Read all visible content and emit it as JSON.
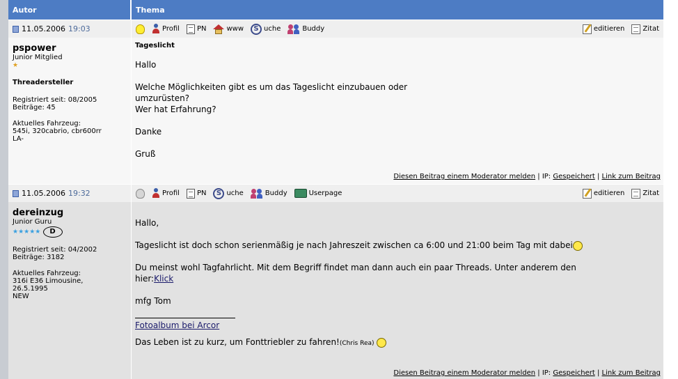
{
  "header": {
    "autor": "Autor",
    "thema": "Thema"
  },
  "tools_labels": {
    "profil": "Profil",
    "pn": "PN",
    "www": "www",
    "suche": "uche",
    "buddy": "Buddy",
    "userpage": "Userpage",
    "editieren": "editieren",
    "zitat": "Zitat"
  },
  "footer": {
    "report": "Diesen Beitrag einem Moderator melden",
    "sep1": "|",
    "ip_label": "IP:",
    "ip_value": "Gespeichert",
    "sep2": "|",
    "link": "Link zum Beitrag"
  },
  "posts": [
    {
      "date": "11.05.2006",
      "time": "19:03",
      "username": "pspower",
      "rank": "Junior Mitglied",
      "stars": "★",
      "role": "Threadersteller",
      "registered": "Registriert seit: 08/2005",
      "posts": "Beiträge: 45",
      "vehicle_label": "Aktuelles Fahrzeug:",
      "vehicle_1": "545i, 320cabrio, cbr600rr",
      "vehicle_2": "LA-",
      "title": "Tageslicht",
      "lines": [
        "Hallo",
        "Welche Möglichkeiten gibt es um das Tageslicht einzubauen oder",
        "umzurüsten?",
        "Wer hat Erfahrung?",
        "Danke",
        "Gruß"
      ]
    },
    {
      "date": "11.05.2006",
      "time": "19:32",
      "username": "dereinzug",
      "rank": "Junior Guru",
      "stars": "★★★★★",
      "badge": "D",
      "registered": "Registriert seit: 04/2002",
      "posts": "Beiträge: 3182",
      "vehicle_label": "Aktuelles Fahrzeug:",
      "vehicle_1": "316i E36 Limousine,",
      "vehicle_2": "26.5.1995",
      "vehicle_3": "NEW",
      "lines": [
        "Hallo,",
        "Tageslicht ist doch schon serienmäßig je nach Jahreszeit zwischen ca 6:00 und 21:00 beim Tag mit dabei",
        "Du meinst wohl Tagfahrlicht. Mit dem Begriff findet man dann auch ein paar Threads. Unter anderem den",
        "hier:",
        "Klick",
        "mfg Tom"
      ],
      "sig_link": "Fotoalbum bei Arcor",
      "sig_text": "Das Leben ist zu kurz, um Fonttriebler zu fahren!",
      "sig_author": "(Chris Rea)"
    }
  ]
}
